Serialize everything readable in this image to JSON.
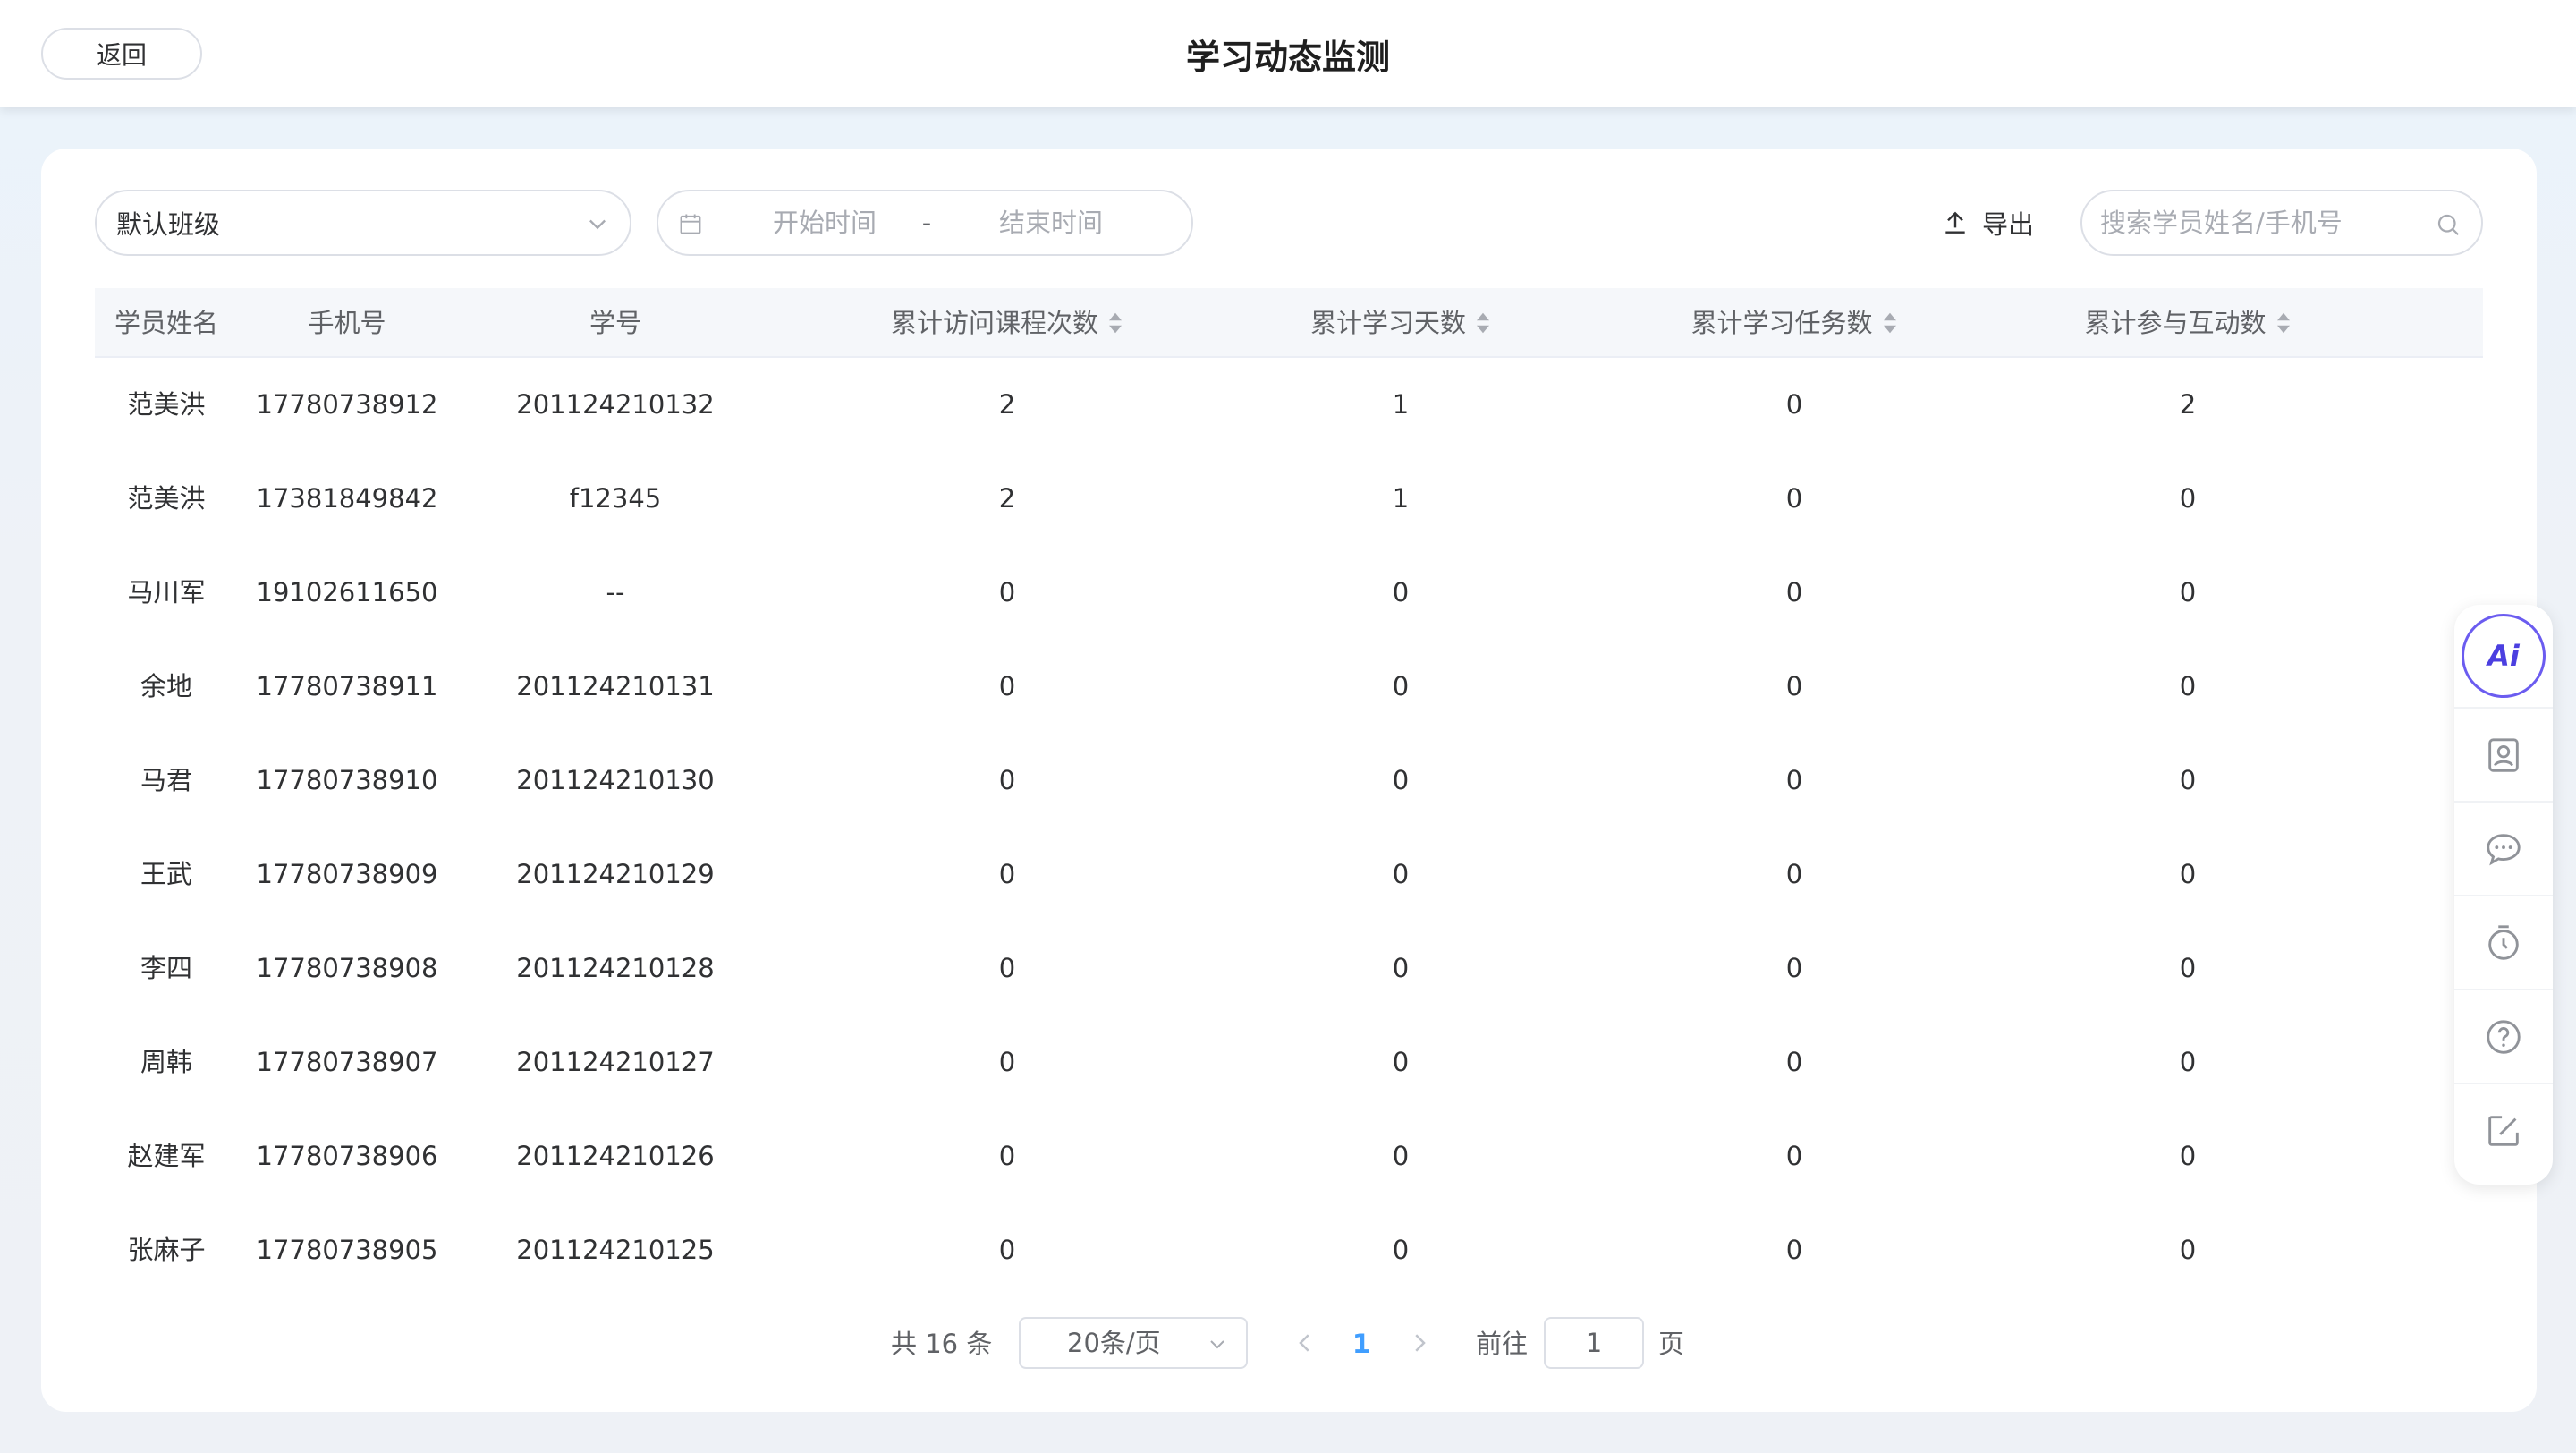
{
  "header": {
    "back_label": "返回",
    "title": "学习动态监测"
  },
  "filters": {
    "class_select": "默认班级",
    "start_placeholder": "开始时间",
    "range_separator": "-",
    "end_placeholder": "结束时间",
    "export_label": "导出",
    "search_placeholder": "搜索学员姓名/手机号"
  },
  "table": {
    "columns": [
      "学员姓名",
      "手机号",
      "学号",
      "累计访问课程次数",
      "累计学习天数",
      "累计学习任务数",
      "累计参与互动数"
    ],
    "rows": [
      [
        "范美洪",
        "17780738912",
        "201124210132",
        "2",
        "1",
        "0",
        "2"
      ],
      [
        "范美洪",
        "17381849842",
        "f12345",
        "2",
        "1",
        "0",
        "0"
      ],
      [
        "马川军",
        "19102611650",
        "--",
        "0",
        "0",
        "0",
        "0"
      ],
      [
        "余地",
        "17780738911",
        "201124210131",
        "0",
        "0",
        "0",
        "0"
      ],
      [
        "马君",
        "17780738910",
        "201124210130",
        "0",
        "0",
        "0",
        "0"
      ],
      [
        "王武",
        "17780738909",
        "201124210129",
        "0",
        "0",
        "0",
        "0"
      ],
      [
        "李四",
        "17780738908",
        "201124210128",
        "0",
        "0",
        "0",
        "0"
      ],
      [
        "周韩",
        "17780738907",
        "201124210127",
        "0",
        "0",
        "0",
        "0"
      ],
      [
        "赵建军",
        "17780738906",
        "201124210126",
        "0",
        "0",
        "0",
        "0"
      ],
      [
        "张麻子",
        "17780738905",
        "201124210125",
        "0",
        "0",
        "0",
        "0"
      ]
    ]
  },
  "pagination": {
    "total_label": "共 16 条",
    "page_size": "20条/页",
    "current_page": "1",
    "goto_label": "前往",
    "goto_value": "1",
    "page_suffix": "页"
  },
  "side_toolbar": {
    "ai_label": "Ai",
    "icons": [
      "contact-card-icon",
      "chat-icon",
      "timer-icon",
      "help-icon",
      "edit-icon"
    ]
  },
  "colors": {
    "accent": "#409eff",
    "ai_ring": "#6b5cf0"
  }
}
